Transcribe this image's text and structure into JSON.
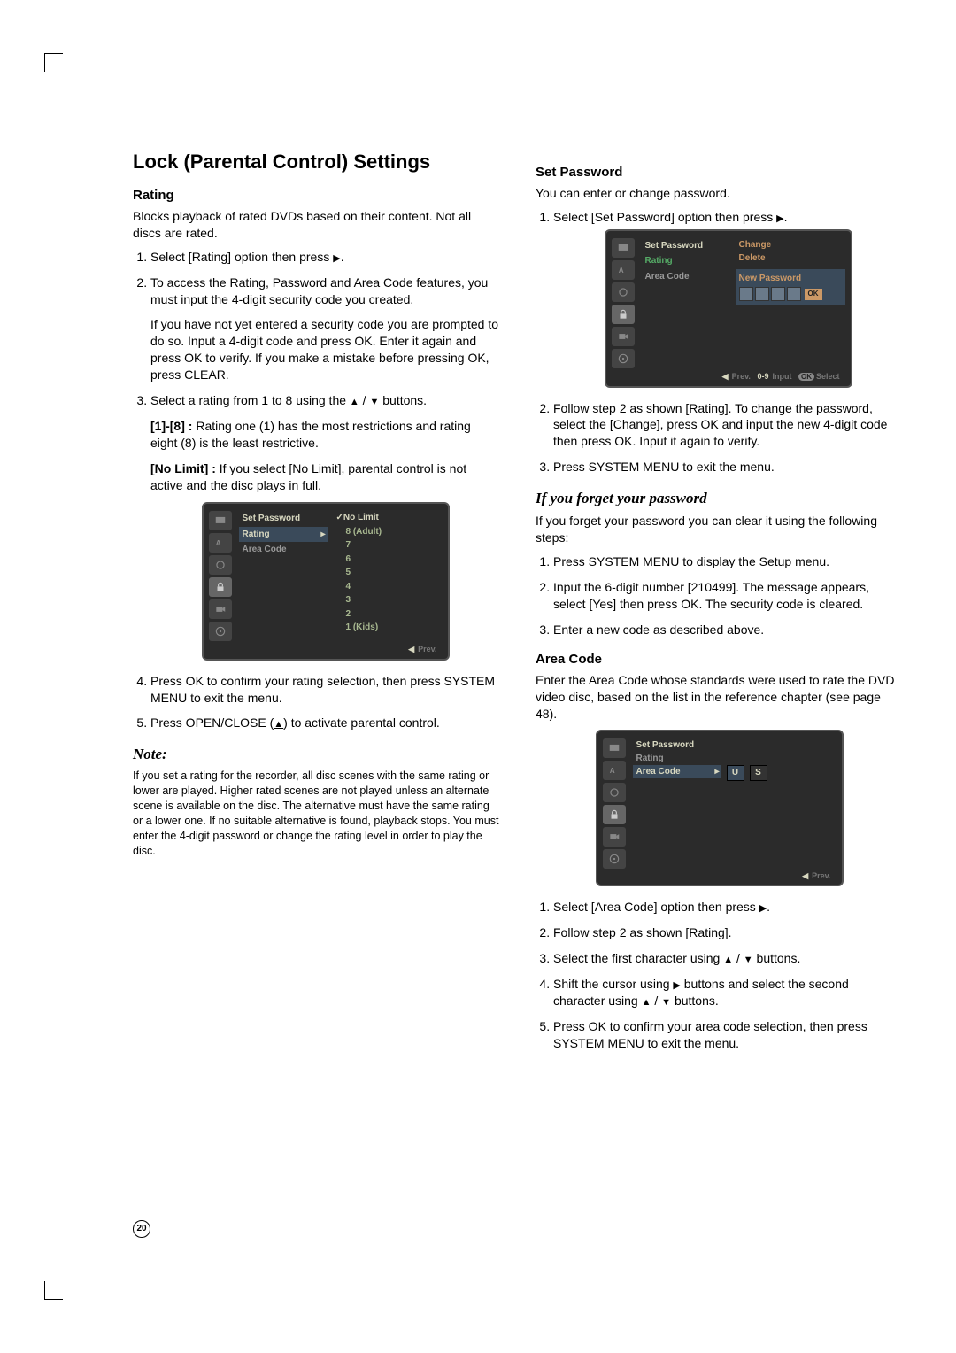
{
  "page_number": "20",
  "heading_main": "Lock (Parental Control) Settings",
  "left": {
    "rating_heading": "Rating",
    "rating_intro": "Blocks playback of rated DVDs based on their content. Not all discs are rated.",
    "rating_step1_a": "Select [Rating] option then press ",
    "rating_step1_b": ".",
    "rating_step2": "To access the Rating, Password and Area Code features, you must input the 4-digit security code you created.",
    "rating_step2_note": "If you have not yet entered a security code you are prompted to do so. Input a 4-digit code and press OK. Enter it again and press OK to verify. If you make a mistake before pressing OK, press CLEAR.",
    "rating_step3_a": "Select a rating from 1 to 8 using the ",
    "rating_step3_b": " / ",
    "rating_step3_c": " buttons.",
    "rating_18_label": "[1]-[8] :",
    "rating_18_text": " Rating one (1) has the most restrictions and rating eight (8) is the least restrictive.",
    "rating_nolimit_label": "[No Limit] :",
    "rating_nolimit_text": " If you select [No Limit], parental control is not active and the disc plays in full.",
    "rating_step4": "Press OK to confirm your rating selection, then press SYSTEM MENU to exit the menu.",
    "rating_step5_a": "Press OPEN/CLOSE (",
    "rating_step5_b": ") to activate parental control.",
    "note_heading": "Note:",
    "note_body": "If you set a rating for the recorder, all disc scenes with the same rating or lower are played. Higher rated scenes are not played unless an alternate scene is available on the disc. The alternative must have the same rating or a lower one. If no suitable alternative is found, playback stops. You must enter the 4-digit password or change the rating level in order to play the disc.",
    "osd": {
      "menu": [
        "Set Password",
        "Rating",
        "Area Code"
      ],
      "options": [
        "No Limit",
        "8 (Adult)",
        "7",
        "6",
        "5",
        "4",
        "3",
        "2",
        "1 (Kids)"
      ],
      "footer_prev": "Prev.",
      "footer_left": "◀"
    }
  },
  "right": {
    "setpw_heading": "Set Password",
    "setpw_intro": "You can enter or change password.",
    "setpw_step1_a": "Select [Set Password] option then press ",
    "setpw_step1_b": ".",
    "setpw_osd": {
      "menu": [
        "Set Password",
        "Rating",
        "Area Code"
      ],
      "right_items": [
        "Change",
        "Delete"
      ],
      "newpw_label": "New Password",
      "ok": "OK",
      "footer_prev": "Prev.",
      "footer_input": "Input",
      "footer_select": "Select",
      "footer_09": "0-9",
      "footer_ok": "OK",
      "footer_left": "◀"
    },
    "setpw_step2": "Follow step 2 as shown [Rating]. To change the password, select the [Change], press OK and input the new 4-digit code then press OK. Input it again to verify.",
    "setpw_step3": "Press SYSTEM MENU to exit the menu.",
    "forget_heading": "If you forget your password",
    "forget_intro": "If you forget your password you can clear it using the following steps:",
    "forget_step1": "Press SYSTEM MENU to display the Setup menu.",
    "forget_step2": "Input the 6-digit number [210499]. The message appears, select [Yes] then press OK. The security code is cleared.",
    "forget_step3": "Enter a new code as described above.",
    "ac_heading": "Area Code",
    "ac_intro": "Enter the Area Code whose standards were used to rate the DVD video disc, based on the list in the reference chapter (see page 48).",
    "ac_osd": {
      "menu": [
        "Set Password",
        "Rating",
        "Area Code"
      ],
      "chars": [
        "U",
        "S"
      ],
      "footer_prev": "Prev.",
      "footer_left": "◀"
    },
    "ac_step1_a": "Select [Area Code] option then press ",
    "ac_step1_b": ".",
    "ac_step2": "Follow step 2 as shown [Rating].",
    "ac_step3_a": "Select the first character using ",
    "ac_step3_b": " / ",
    "ac_step3_c": " buttons.",
    "ac_step4_a": "Shift the cursor using ",
    "ac_step4_b": " buttons and select the second character using ",
    "ac_step4_c": " / ",
    "ac_step4_d": " buttons.",
    "ac_step5": "Press OK to confirm your area code selection, then press SYSTEM MENU to exit the menu."
  }
}
